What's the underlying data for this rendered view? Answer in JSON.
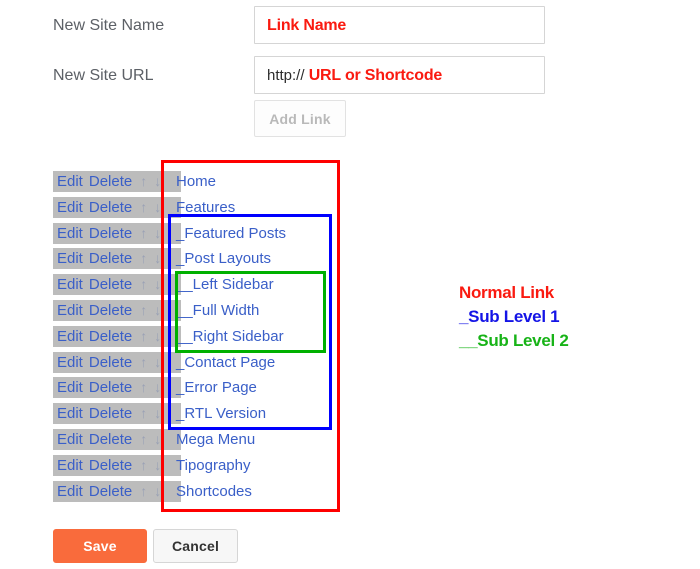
{
  "form": {
    "name_label": "New Site Name",
    "name_value": "Link Name",
    "url_label": "New Site URL",
    "url_protocol": "http://",
    "url_value": "URL or Shortcode",
    "add_link_label": "Add Link"
  },
  "row_controls": {
    "edit_label": "Edit",
    "delete_label": "Delete",
    "up_icon": "↑",
    "down_icon": "↓"
  },
  "menu_items": [
    {
      "label": "Home",
      "level": 0
    },
    {
      "label": "Features",
      "level": 0
    },
    {
      "label": "_Featured Posts",
      "level": 1
    },
    {
      "label": "_Post Layouts",
      "level": 1
    },
    {
      "label": "__Left Sidebar",
      "level": 2
    },
    {
      "label": "__Full Width",
      "level": 2
    },
    {
      "label": "__Right Sidebar",
      "level": 2
    },
    {
      "label": "_Contact Page",
      "level": 1
    },
    {
      "label": "_Error Page",
      "level": 1
    },
    {
      "label": "_RTL Version",
      "level": 1
    },
    {
      "label": "Mega Menu",
      "level": 0
    },
    {
      "label": "Tipography",
      "level": 0
    },
    {
      "label": "Shortcodes",
      "level": 0
    }
  ],
  "legend": {
    "normal": "Normal Link",
    "sub1": "_Sub Level 1",
    "sub2": "__Sub Level 2"
  },
  "annotations": {
    "red_color": "#fe0000",
    "blue_color": "#0000fe",
    "green_color": "#00b000"
  },
  "footer": {
    "save_label": "Save",
    "cancel_label": "Cancel"
  }
}
